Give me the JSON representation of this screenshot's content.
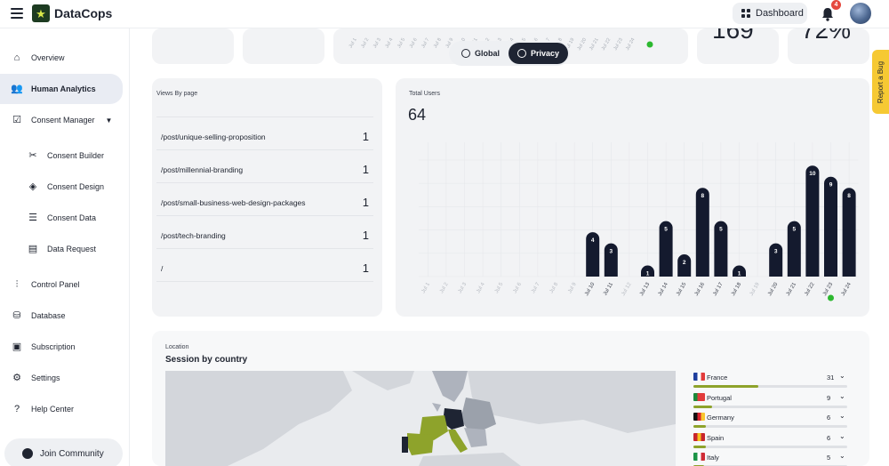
{
  "app": {
    "name": "DataCops"
  },
  "header": {
    "dashboard_label": "Dashboard",
    "notification_count": "4"
  },
  "sidebar": {
    "items": [
      {
        "label": "Overview",
        "icon": "home-icon"
      },
      {
        "label": "Human Analytics",
        "icon": "users-icon",
        "active": true
      },
      {
        "label": "Consent Manager",
        "icon": "consent-icon",
        "expanded": true
      },
      {
        "label": "Consent Builder",
        "icon": "tools-icon",
        "sub": true
      },
      {
        "label": "Consent Design",
        "icon": "paint-bucket-icon",
        "sub": true
      },
      {
        "label": "Consent Data",
        "icon": "list-icon",
        "sub": true
      },
      {
        "label": "Data Request",
        "icon": "table-icon",
        "sub": true
      },
      {
        "label": "Control Panel",
        "icon": "sliders-icon"
      },
      {
        "label": "Database",
        "icon": "database-icon"
      },
      {
        "label": "Subscription",
        "icon": "wallet-icon"
      },
      {
        "label": "Settings",
        "icon": "gear-icon"
      },
      {
        "label": "Help Center",
        "icon": "help-icon"
      }
    ],
    "join_label": "Join Community"
  },
  "stats": {
    "left_value": "169",
    "right_value": "72%"
  },
  "toggle": {
    "global_label": "Global",
    "privacy_label": "Privacy",
    "selected": "Privacy"
  },
  "views_by_page": {
    "title": "Views By page",
    "rows": [
      {
        "path": "/post/unique-selling-proposition",
        "count": "1"
      },
      {
        "path": "/post/millennial-branding",
        "count": "1"
      },
      {
        "path": "/post/small-business-web-design-packages",
        "count": "1"
      },
      {
        "path": "/post/tech-branding",
        "count": "1"
      },
      {
        "path": "/",
        "count": "1"
      }
    ]
  },
  "total_users": {
    "title": "Total Users",
    "value": "64"
  },
  "chart_data": {
    "type": "bar",
    "title": "Total Users",
    "categories": [
      "Jul 1",
      "Jul 2",
      "Jul 3",
      "Jul 4",
      "Jul 5",
      "Jul 6",
      "Jul 7",
      "Jul 8",
      "Jul 9",
      "Jul 10",
      "Jul 11",
      "Jul 12",
      "Jul 13",
      "Jul 14",
      "Jul 15",
      "Jul 16",
      "Jul 17",
      "Jul 18",
      "Jul 19",
      "Jul 20",
      "Jul 21",
      "Jul 22",
      "Jul 23",
      "Jul 24"
    ],
    "values": [
      0,
      0,
      0,
      0,
      0,
      0,
      0,
      0,
      0,
      4,
      3,
      0,
      1,
      5,
      2,
      8,
      5,
      1,
      0,
      3,
      5,
      10,
      9,
      8
    ],
    "ylim": [
      0,
      10.5
    ],
    "bar_color": "#141a2e",
    "grid": true
  },
  "location": {
    "label": "Location",
    "title": "Session by country",
    "countries": [
      {
        "name": "France",
        "value": "31",
        "share": 0.42,
        "flag_colors": [
          "#1f3f9e",
          "#ffffff",
          "#e23b3b"
        ]
      },
      {
        "name": "Portugal",
        "value": "9",
        "share": 0.12,
        "flag_colors": [
          "#1b8a3a",
          "#e23b3b",
          "#e23b3b"
        ]
      },
      {
        "name": "Germany",
        "value": "6",
        "share": 0.08,
        "flag_colors": [
          "#111111",
          "#d9232e",
          "#f7c62f"
        ]
      },
      {
        "name": "Spain",
        "value": "6",
        "share": 0.08,
        "flag_colors": [
          "#c8252c",
          "#f6c420",
          "#c8252c"
        ]
      },
      {
        "name": "Italy",
        "value": "5",
        "share": 0.07,
        "flag_colors": [
          "#1c9447",
          "#ffffff",
          "#cf2b36"
        ]
      }
    ]
  },
  "report_bug_label": "Report a Bug",
  "colors": {
    "accent": "#8ea32b",
    "dark": "#141a2e",
    "card_bg": "#f2f3f5"
  }
}
